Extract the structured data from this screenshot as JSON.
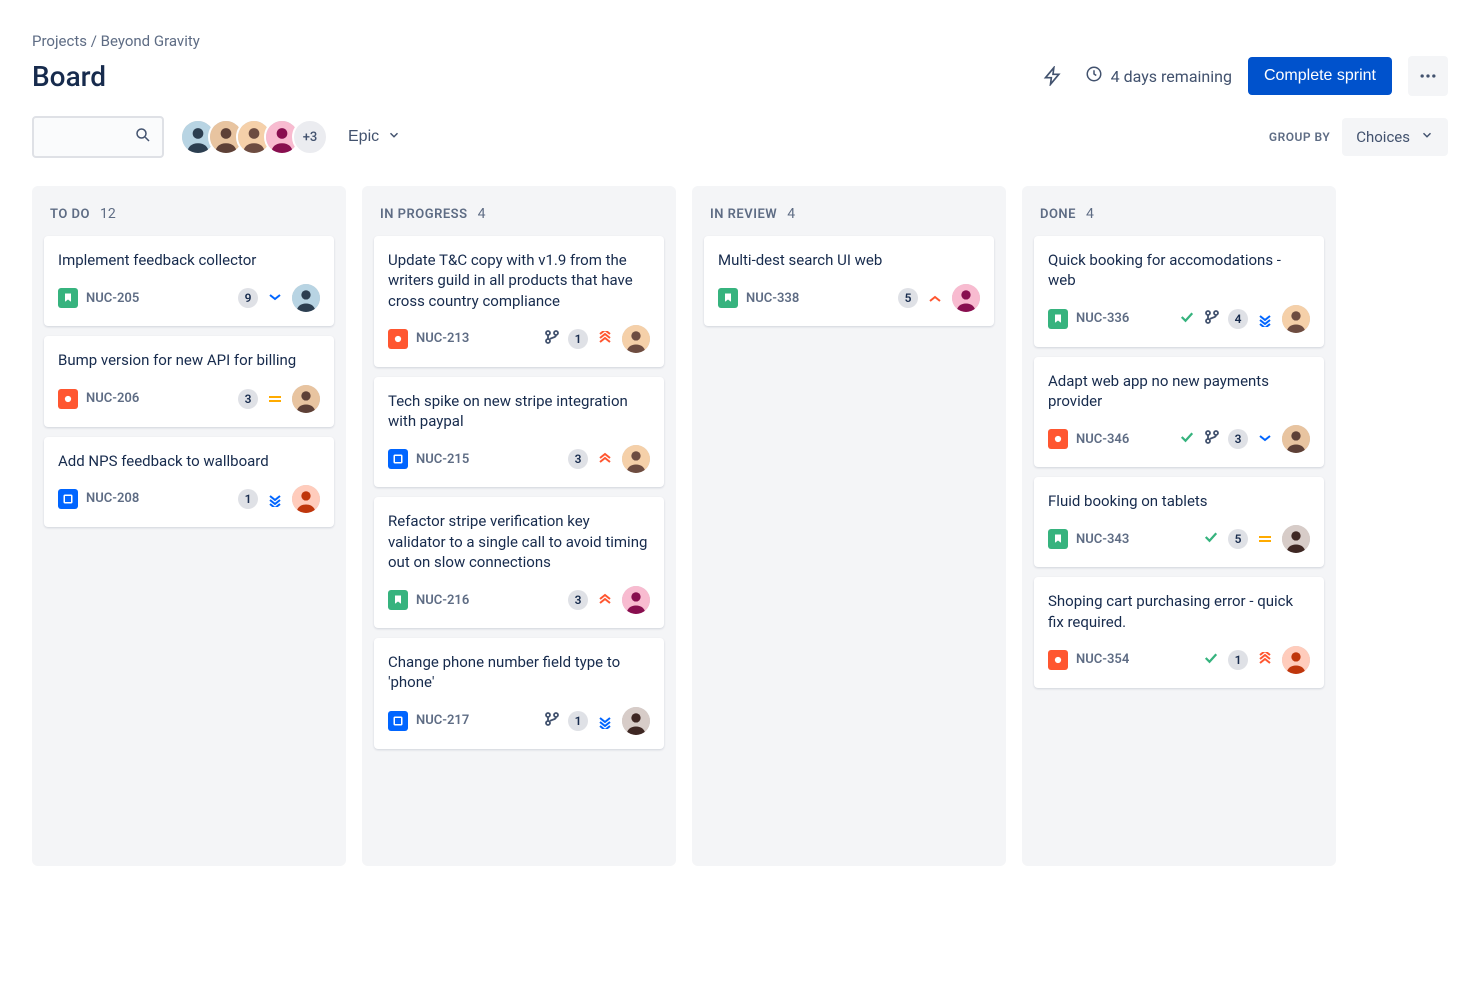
{
  "breadcrumb": {
    "projects": "Projects",
    "project_name": "Beyond Gravity"
  },
  "page_title": "Board",
  "header": {
    "remaining": "4 days remaining",
    "complete_btn": "Complete sprint"
  },
  "controls": {
    "epic": "Epic",
    "group_by_label": "GROUP BY",
    "group_by_value": "Choices",
    "avatar_extra": "+3"
  },
  "columns": [
    {
      "title": "TO DO",
      "count": "12",
      "cards": [
        {
          "title": "Implement feedback collector",
          "type": "story",
          "key": "NUC-205",
          "badge": "9",
          "priority": "low",
          "assignee": 0
        },
        {
          "title": "Bump version for new API for billing",
          "type": "bug",
          "key": "NUC-206",
          "badge": "3",
          "priority": "medium",
          "assignee": 1
        },
        {
          "title": "Add NPS feedback to wallboard",
          "type": "task",
          "key": "NUC-208",
          "badge": "1",
          "priority": "lowest",
          "assignee": 5
        }
      ]
    },
    {
      "title": "IN PROGRESS",
      "count": "4",
      "cards": [
        {
          "title": "Update T&C copy with v1.9 from the writers guild in all products that have cross country compliance",
          "type": "bug",
          "key": "NUC-213",
          "branch": true,
          "badge": "1",
          "priority": "highest",
          "assignee": 2
        },
        {
          "title": "Tech spike on new stripe integration with paypal",
          "type": "task",
          "key": "NUC-215",
          "badge": "3",
          "priority": "high",
          "assignee": 2
        },
        {
          "title": "Refactor stripe verification key validator to a single call to avoid timing out on slow connections",
          "type": "story",
          "key": "NUC-216",
          "badge": "3",
          "priority": "high",
          "assignee": 3
        },
        {
          "title": "Change phone number field type to 'phone'",
          "type": "task",
          "key": "NUC-217",
          "branch": true,
          "badge": "1",
          "priority": "lowest",
          "assignee": 4
        }
      ]
    },
    {
      "title": "IN REVIEW",
      "count": "4",
      "cards": [
        {
          "title": "Multi-dest search UI web",
          "type": "story",
          "key": "NUC-338",
          "badge": "5",
          "priority": "high-single",
          "assignee": 3
        }
      ]
    },
    {
      "title": "DONE",
      "count": "4",
      "cards": [
        {
          "title": "Quick booking for accomodations - web",
          "type": "story",
          "key": "NUC-336",
          "done": true,
          "branch": true,
          "badge": "4",
          "priority": "lowest",
          "assignee": 2
        },
        {
          "title": "Adapt web app no new payments provider",
          "type": "bug",
          "key": "NUC-346",
          "done": true,
          "branch": true,
          "badge": "3",
          "priority": "low",
          "assignee": 1
        },
        {
          "title": "Fluid booking on tablets",
          "type": "story",
          "key": "NUC-343",
          "done": true,
          "badge": "5",
          "priority": "medium",
          "assignee": 4
        },
        {
          "title": "Shoping cart purchasing error - quick fix required.",
          "type": "bug",
          "key": "NUC-354",
          "done": true,
          "badge": "1",
          "priority": "highest",
          "assignee": 5
        }
      ]
    }
  ],
  "avatar_colors": [
    [
      "#b8d4e3",
      "#2c3e50"
    ],
    [
      "#e8c4a0",
      "#5d4037"
    ],
    [
      "#f5d0a9",
      "#6d4c41"
    ],
    [
      "#f8bbd0",
      "#880e4f"
    ],
    [
      "#d7ccc8",
      "#3e2723"
    ],
    [
      "#ffccbc",
      "#bf360c"
    ]
  ]
}
